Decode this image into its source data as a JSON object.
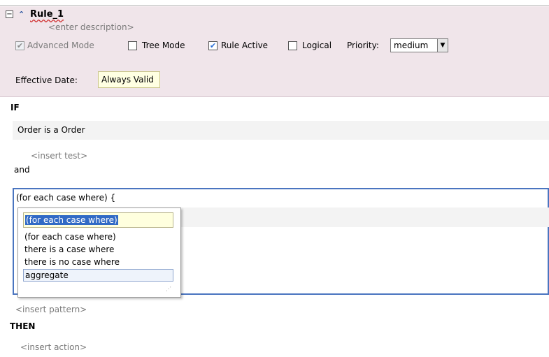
{
  "rule": {
    "collapse_glyph": "−",
    "chevron_glyph": "⌃",
    "name": "Rule_1",
    "description_placeholder": "<enter description>",
    "advanced_mode": {
      "label": "Advanced Mode",
      "checked": true,
      "disabled": true
    },
    "tree_mode": {
      "label": "Tree Mode",
      "checked": false
    },
    "rule_active": {
      "label": "Rule Active",
      "checked": true
    },
    "logical": {
      "label": "Logical",
      "checked": false
    },
    "priority_label": "Priority:",
    "priority_value": "medium",
    "effective_date_label": "Effective Date:",
    "effective_date_value": "Always Valid"
  },
  "if_block": {
    "keyword": "IF",
    "pattern": "Order is a Order",
    "insert_test": "<insert test>",
    "and_label": "and",
    "edit_text": "(for each case where)  {",
    "insert_pattern": "<insert pattern>"
  },
  "popup": {
    "input_value": "(for each case where)",
    "options": [
      "(for each case where)",
      "there is a case where",
      "there is no case where",
      "aggregate"
    ],
    "selected_index": 3
  },
  "then_block": {
    "keyword": "THEN",
    "insert_action": "<insert action>"
  },
  "icons": {
    "checkmark": "✔",
    "dropdown_arrow": "▼",
    "grip": "⋰"
  },
  "colors": {
    "header_bg": "#f0e5ea",
    "focus_border": "#4a75c0",
    "selection": "#316ac5"
  }
}
